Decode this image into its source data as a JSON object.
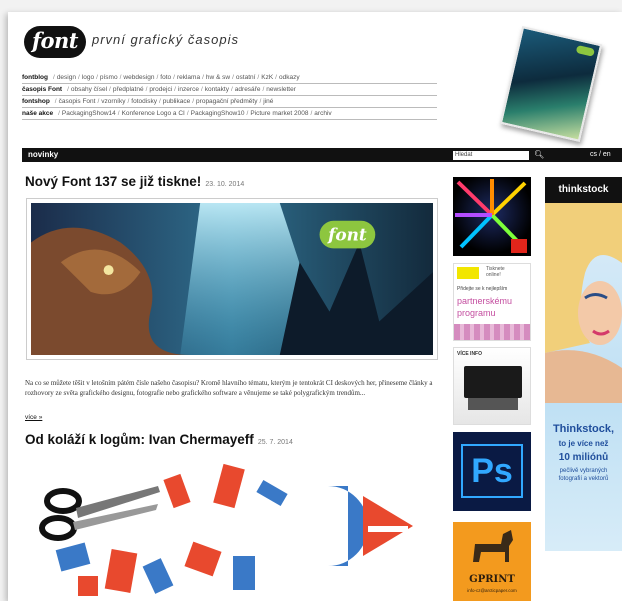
{
  "header": {
    "logo_text": "font",
    "tagline": "první grafický časopis"
  },
  "nav": [
    {
      "head": "fontblog",
      "items": [
        "design",
        "logo",
        "písmo",
        "webdesign",
        "foto",
        "reklama",
        "hw & sw",
        "ostatní",
        "KzK",
        "odkazy"
      ]
    },
    {
      "head": "časopis Font",
      "items": [
        "obsahy čísel",
        "předplatné",
        "prodejci",
        "inzerce",
        "kontakty",
        "adresáře",
        "newsletter"
      ]
    },
    {
      "head": "fontshop",
      "items": [
        "časopis Font",
        "vzorníky",
        "fotodisky",
        "publikace",
        "propagační předměty",
        "jiné"
      ]
    },
    {
      "head": "naše akce",
      "items": [
        "PackagingShow14",
        "Konference Logo a CI",
        "PackagingShow10",
        "Picture market 2008",
        "archiv"
      ]
    }
  ],
  "bar": {
    "section": "novinky",
    "search_placeholder": "Hledat",
    "lang": "cs / en"
  },
  "articles": [
    {
      "title": "Nový Font 137 se již tiskne!",
      "date": "23. 10. 2014",
      "excerpt": "Na co se můžete těšit v letošním pátém čísle našeho časopisu? Kromě hlavního tématu, kterým je tentokrát CI deskových her, přineseme články a rozhovory ze světa grafického designu, fotografie nebo grafického software a věnujeme se také polygrafickým trendům...",
      "more": "více »"
    },
    {
      "title": "Od koláží k logům: Ivan Chermayeff",
      "date": "25. 7. 2014"
    }
  ],
  "ads": {
    "ad2_line1": "Tisknete",
    "ad2_line2": "online!",
    "ad2_line3": "Přidejte se k nejlepším",
    "ad2_line4": "partnerskému",
    "ad2_line5": "programu",
    "ad3_label": "VÍCE INFO",
    "ad4_text": "Ps",
    "ad5_title": "GPRINT",
    "ad5_sub": "info-cz@arcticpaper.com",
    "sky_brand": "thinkstock",
    "sky_t1": "Thinkstock,",
    "sky_t2": "to je více než",
    "sky_t3": "10 miliónů",
    "sky_t4": "pečlivě vybraných fotografií a vektorů"
  },
  "colors": {
    "accent_green": "#8dc63f",
    "ps_blue": "#31a8ff",
    "gprint_orange": "#f39a1e"
  }
}
